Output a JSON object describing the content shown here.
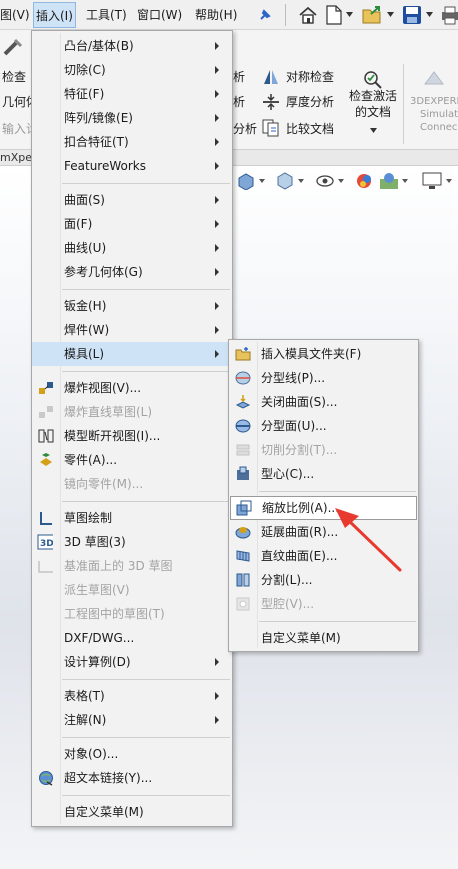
{
  "menubar": {
    "items": [
      "图(V)",
      "插入(I)",
      "工具(T)",
      "窗口(W)",
      "帮助(H)"
    ]
  },
  "ribbon": {
    "left": [
      "检查",
      "几何体",
      "输入诊"
    ],
    "analysis_partial": [
      "析",
      "析",
      "分析"
    ],
    "symmetry_check": "对称检查",
    "thickness_analysis": "厚度分析",
    "compare_docs": "比较文档",
    "check_active_doc_line1": "检查激活",
    "check_active_doc_line2": "的文档",
    "experience_line1": "3DEXPERI",
    "experience_line2": "Simulati",
    "experience_line3": "Connec",
    "tab_partial": "mXper"
  },
  "insert_menu": {
    "items": [
      {
        "label": "凸台/基体(B)",
        "submenu": true,
        "disabled": false
      },
      {
        "label": "切除(C)",
        "submenu": true,
        "disabled": false
      },
      {
        "label": "特征(F)",
        "submenu": true,
        "disabled": false
      },
      {
        "label": "阵列/镜像(E)",
        "submenu": true,
        "disabled": false
      },
      {
        "label": "扣合特征(T)",
        "submenu": true,
        "disabled": false
      },
      {
        "label": "FeatureWorks",
        "submenu": true,
        "disabled": false
      },
      {
        "label": "曲面(S)",
        "submenu": true,
        "disabled": false
      },
      {
        "label": "面(F)",
        "submenu": true,
        "disabled": false
      },
      {
        "label": "曲线(U)",
        "submenu": true,
        "disabled": false
      },
      {
        "label": "参考几何体(G)",
        "submenu": true,
        "disabled": false
      },
      {
        "label": "钣金(H)",
        "submenu": true,
        "disabled": false
      },
      {
        "label": "焊件(W)",
        "submenu": true,
        "disabled": false
      },
      {
        "label": "模具(L)",
        "submenu": true,
        "disabled": false
      },
      {
        "label": "爆炸视图(V)...",
        "submenu": false,
        "disabled": false
      },
      {
        "label": "爆炸直线草图(L)",
        "submenu": false,
        "disabled": true
      },
      {
        "label": "模型断开视图(I)...",
        "submenu": false,
        "disabled": false
      },
      {
        "label": "零件(A)...",
        "submenu": false,
        "disabled": false
      },
      {
        "label": "镜向零件(M)...",
        "submenu": false,
        "disabled": true
      },
      {
        "label": "草图绘制",
        "submenu": false,
        "disabled": false
      },
      {
        "label": "3D 草图(3)",
        "submenu": false,
        "disabled": false
      },
      {
        "label": "基准面上的 3D 草图",
        "submenu": false,
        "disabled": true
      },
      {
        "label": "派生草图(V)",
        "submenu": false,
        "disabled": true
      },
      {
        "label": "工程图中的草图(T)",
        "submenu": false,
        "disabled": true
      },
      {
        "label": "DXF/DWG...",
        "submenu": false,
        "disabled": false
      },
      {
        "label": "设计算例(D)",
        "submenu": true,
        "disabled": false
      },
      {
        "label": "表格(T)",
        "submenu": true,
        "disabled": false
      },
      {
        "label": "注解(N)",
        "submenu": true,
        "disabled": false
      },
      {
        "label": "对象(O)...",
        "submenu": false,
        "disabled": false
      },
      {
        "label": "超文本链接(Y)...",
        "submenu": false,
        "disabled": false
      },
      {
        "label": "自定义菜单(M)",
        "submenu": false,
        "disabled": false
      }
    ]
  },
  "mold_submenu": {
    "items": [
      {
        "label": "插入模具文件夹(F)",
        "disabled": false
      },
      {
        "label": "分型线(P)...",
        "disabled": false
      },
      {
        "label": "关闭曲面(S)...",
        "disabled": false
      },
      {
        "label": "分型面(U)...",
        "disabled": false
      },
      {
        "label": "切削分割(T)...",
        "disabled": true
      },
      {
        "label": "型心(C)...",
        "disabled": false
      },
      {
        "label": "缩放比例(A)...",
        "disabled": false
      },
      {
        "label": "延展曲面(R)...",
        "disabled": false
      },
      {
        "label": "直纹曲面(E)...",
        "disabled": false
      },
      {
        "label": "分割(L)...",
        "disabled": false
      },
      {
        "label": "型腔(V)...",
        "disabled": true
      },
      {
        "label": "自定义菜单(M)",
        "disabled": false
      }
    ]
  },
  "colors": {
    "highlight": "#cfe3f7",
    "annotation_arrow": "#e8392f"
  }
}
